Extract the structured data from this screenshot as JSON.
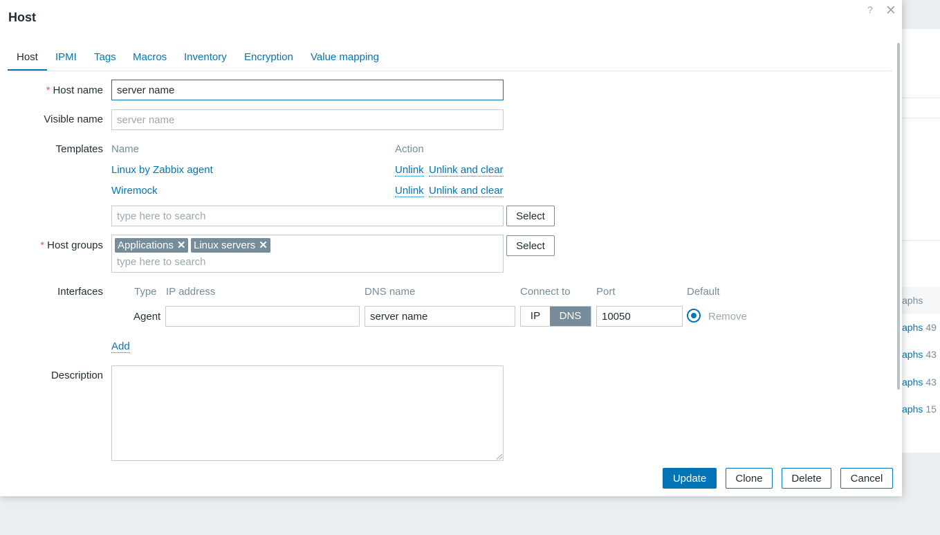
{
  "dialog": {
    "title": "Host",
    "help": "?",
    "close": "✕"
  },
  "tabs": [
    {
      "label": "Host",
      "active": true
    },
    {
      "label": "IPMI"
    },
    {
      "label": "Tags"
    },
    {
      "label": "Macros"
    },
    {
      "label": "Inventory"
    },
    {
      "label": "Encryption"
    },
    {
      "label": "Value mapping"
    }
  ],
  "form": {
    "host_name": {
      "label": "Host name",
      "required_mark": "*",
      "value": "server name"
    },
    "visible_name": {
      "label": "Visible name",
      "placeholder": "server name",
      "value": ""
    },
    "templates": {
      "label": "Templates",
      "col_name": "Name",
      "col_action": "Action",
      "rows": [
        {
          "name": "Linux by Zabbix agent",
          "unlink": "Unlink",
          "unlink_clear": "Unlink and clear"
        },
        {
          "name": "Wiremock",
          "unlink": "Unlink",
          "unlink_clear": "Unlink and clear"
        }
      ],
      "search_placeholder": "type here to search",
      "select_label": "Select"
    },
    "host_groups": {
      "label": "Host groups",
      "required_mark": "*",
      "chips": [
        "Applications",
        "Linux servers"
      ],
      "chip_remove": "✕",
      "search_placeholder": "type here to search",
      "select_label": "Select"
    },
    "interfaces": {
      "label": "Interfaces",
      "headers": {
        "type": "Type",
        "ip": "IP address",
        "dns": "DNS name",
        "connect": "Connect to",
        "port": "Port",
        "default": "Default"
      },
      "rows": [
        {
          "type": "Agent",
          "ip": "",
          "dns": "server name",
          "connect_ip": "IP",
          "connect_dns": "DNS",
          "connect_selected": "DNS",
          "port": "10050",
          "default": true,
          "remove": "Remove"
        }
      ],
      "add": "Add"
    },
    "description": {
      "label": "Description",
      "value": ""
    }
  },
  "buttons": {
    "update": "Update",
    "clone": "Clone",
    "delete": "Delete",
    "cancel": "Cancel"
  },
  "background": {
    "rows": [
      {
        "link": "aphs",
        "count": "49"
      },
      {
        "link": "aphs",
        "count": "43"
      },
      {
        "link": "aphs",
        "count": "43"
      },
      {
        "link": "aphs",
        "count": "15"
      }
    ],
    "header": "aphs"
  },
  "colors": {
    "accent": "#0275b8",
    "required": "#e45959",
    "chip": "#768d99"
  }
}
